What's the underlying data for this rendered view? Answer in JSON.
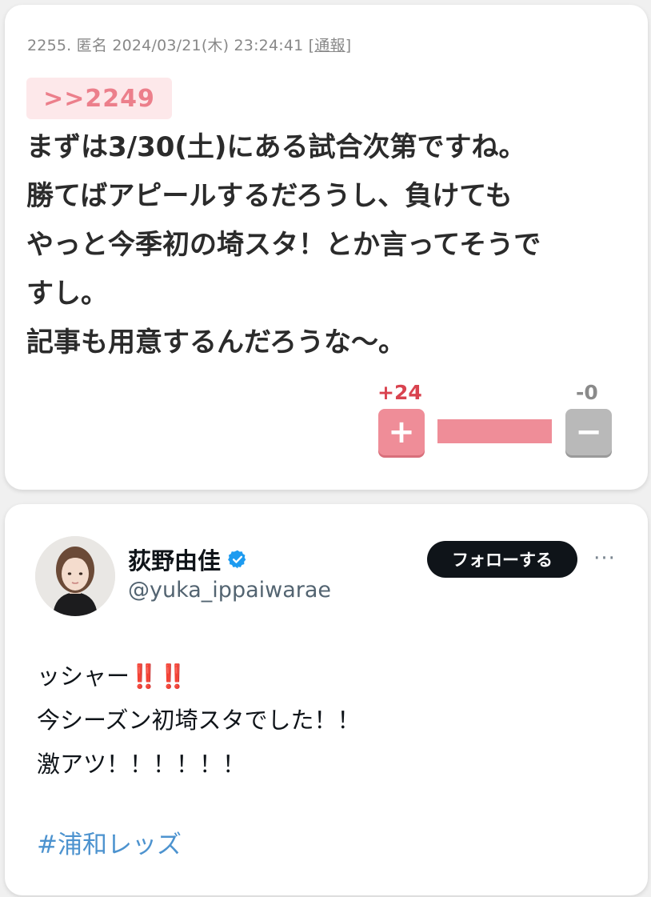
{
  "comment": {
    "number": "2255.",
    "author": "匿名",
    "datetime": "2024/03/21(木) 23:24:41",
    "report_label": "通報",
    "reply_anchor": ">>2249",
    "body": "まずは3/30(土)にある試合次第ですね。\n勝てばアピールするだろうし、負けても\nやっと今季初の埼スタ！とか言ってそうで\nすし。\n記事も用意するんだろうな〜。",
    "votes": {
      "plus_label": "+24",
      "minus_label": "-0",
      "plus_icon": "+",
      "minus_icon": "−",
      "plus_ratio": 1.0
    }
  },
  "tweet": {
    "display_name": "荻野由佳",
    "handle": "@yuka_ippaiwarae",
    "follow_label": "フォローする",
    "more_icon": "···",
    "text_line1": "ッシャー",
    "text_line1_emoji": "‼️‼️",
    "text_line2": "今シーズン初埼スタでした！！",
    "text_line3": "激アツ！！！！！！",
    "hashtag": "#浦和レッズ"
  },
  "colors": {
    "accent_pink": "#ef8d98",
    "anchor_bg": "#fde8ea",
    "plus_count": "#d9434f",
    "verified_blue": "#1d9bf0",
    "hashtag_blue": "#4d93cf"
  }
}
